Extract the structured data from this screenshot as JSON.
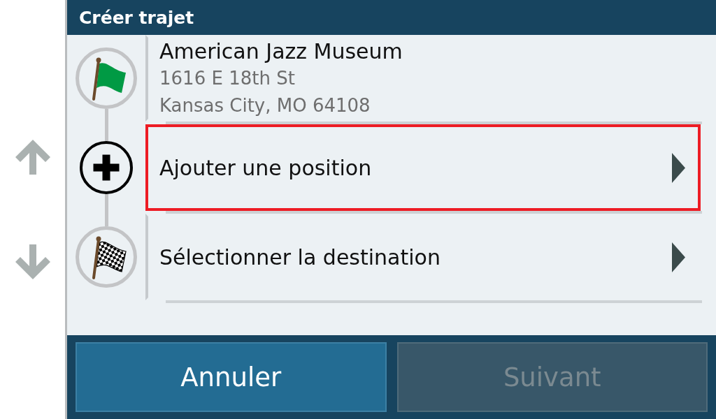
{
  "title_bar": {
    "title": "Créer trajet"
  },
  "stops": [
    {
      "kind": "start",
      "name": "American Jazz Museum",
      "address_lines": [
        "1616 E 18th St",
        "Kansas City, MO 64108"
      ],
      "selected": false
    },
    {
      "kind": "add",
      "label": "Ajouter une position",
      "selected": true
    },
    {
      "kind": "destination",
      "label": "Sélectionner la destination",
      "selected": false
    }
  ],
  "buttons": [
    {
      "label": "Annuler",
      "disabled": false
    },
    {
      "label": "Suivant",
      "disabled": true
    }
  ]
}
